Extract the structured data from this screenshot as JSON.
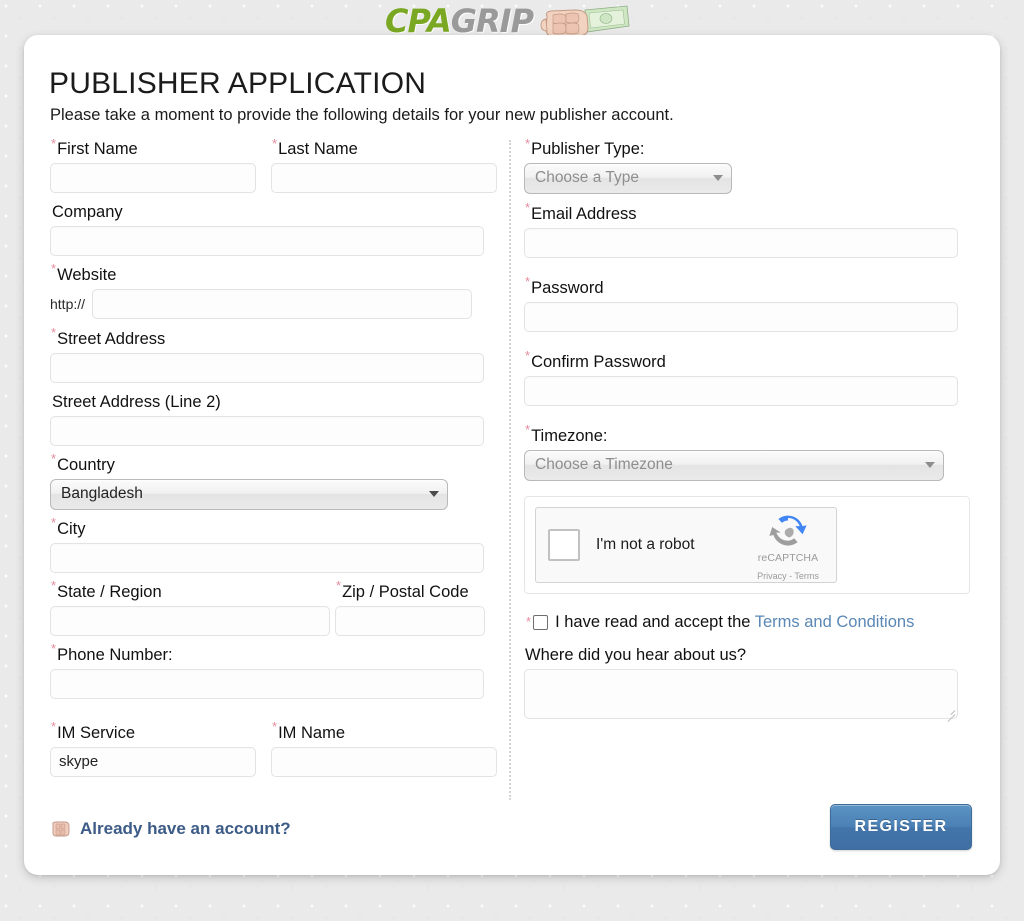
{
  "brand": {
    "name_part1": "CPA",
    "name_part2": "GRIP",
    "fist_icon": "fist-with-money-icon"
  },
  "header": {
    "title": "PUBLISHER APPLICATION",
    "subtitle": "Please take a moment to provide the following details for your new publisher account."
  },
  "left_column": {
    "first_name": {
      "label": "First Name",
      "required": "*",
      "value": "",
      "placeholder": ""
    },
    "last_name": {
      "label": "Last Name",
      "required": "*",
      "value": "",
      "placeholder": ""
    },
    "company": {
      "label": "Company",
      "required": "",
      "value": "",
      "placeholder": ""
    },
    "website": {
      "label": "Website",
      "required": "*",
      "prefix": "http://",
      "value": "",
      "placeholder": ""
    },
    "street_address": {
      "label": "Street Address",
      "required": "*",
      "value": "",
      "placeholder": ""
    },
    "street_address2": {
      "label": "Street Address (Line 2)",
      "required": "",
      "value": "",
      "placeholder": ""
    },
    "country": {
      "label": "Country",
      "required": "*",
      "value": "Bangladesh"
    },
    "city": {
      "label": "City",
      "required": "*",
      "value": "",
      "placeholder": ""
    },
    "state_region": {
      "label": "State / Region",
      "required": "*",
      "value": "",
      "placeholder": ""
    },
    "zip_postal": {
      "label": "Zip / Postal Code",
      "required": "*",
      "value": "",
      "placeholder": ""
    },
    "phone_number": {
      "label": "Phone Number:",
      "required": "*",
      "value": "",
      "placeholder": ""
    },
    "im_service": {
      "label": "IM Service",
      "required": "*",
      "value": "skype"
    },
    "im_name": {
      "label": "IM Name",
      "required": "*",
      "value": "",
      "placeholder": ""
    }
  },
  "right_column": {
    "publisher_type": {
      "label": "Publisher Type:",
      "required": "*",
      "value": "Choose a Type"
    },
    "email_address": {
      "label": "Email Address",
      "required": "*",
      "value": "",
      "placeholder": ""
    },
    "password": {
      "label": "Password",
      "required": "*",
      "value": "",
      "placeholder": ""
    },
    "confirm_password": {
      "label": "Confirm Password",
      "required": "*",
      "value": "",
      "placeholder": ""
    },
    "timezone": {
      "label": "Timezone:",
      "required": "*",
      "value": "Choose a Timezone"
    },
    "captcha": {
      "checkbox_label": "I'm not a robot",
      "brand_name": "reCAPTCHA",
      "links": "Privacy - Terms",
      "logo_icon": "recaptcha-logo-icon"
    },
    "terms": {
      "required": "*",
      "text": "I have read and accept the",
      "link_text": "Terms and Conditions"
    },
    "referral": {
      "label": "Where did you hear about us?",
      "value": "",
      "placeholder": ""
    }
  },
  "footer": {
    "account_link": "Already have an account?",
    "account_icon": "fist-icon",
    "register_button": "REGISTER"
  },
  "colors": {
    "required_asterisk": "#e58b9c",
    "link_blue": "#5b87b5",
    "button_blue": "#4b80b4",
    "account_link_blue": "#3c5b86",
    "logo_green": "#7aa822",
    "logo_gray": "#9a9a9a"
  }
}
